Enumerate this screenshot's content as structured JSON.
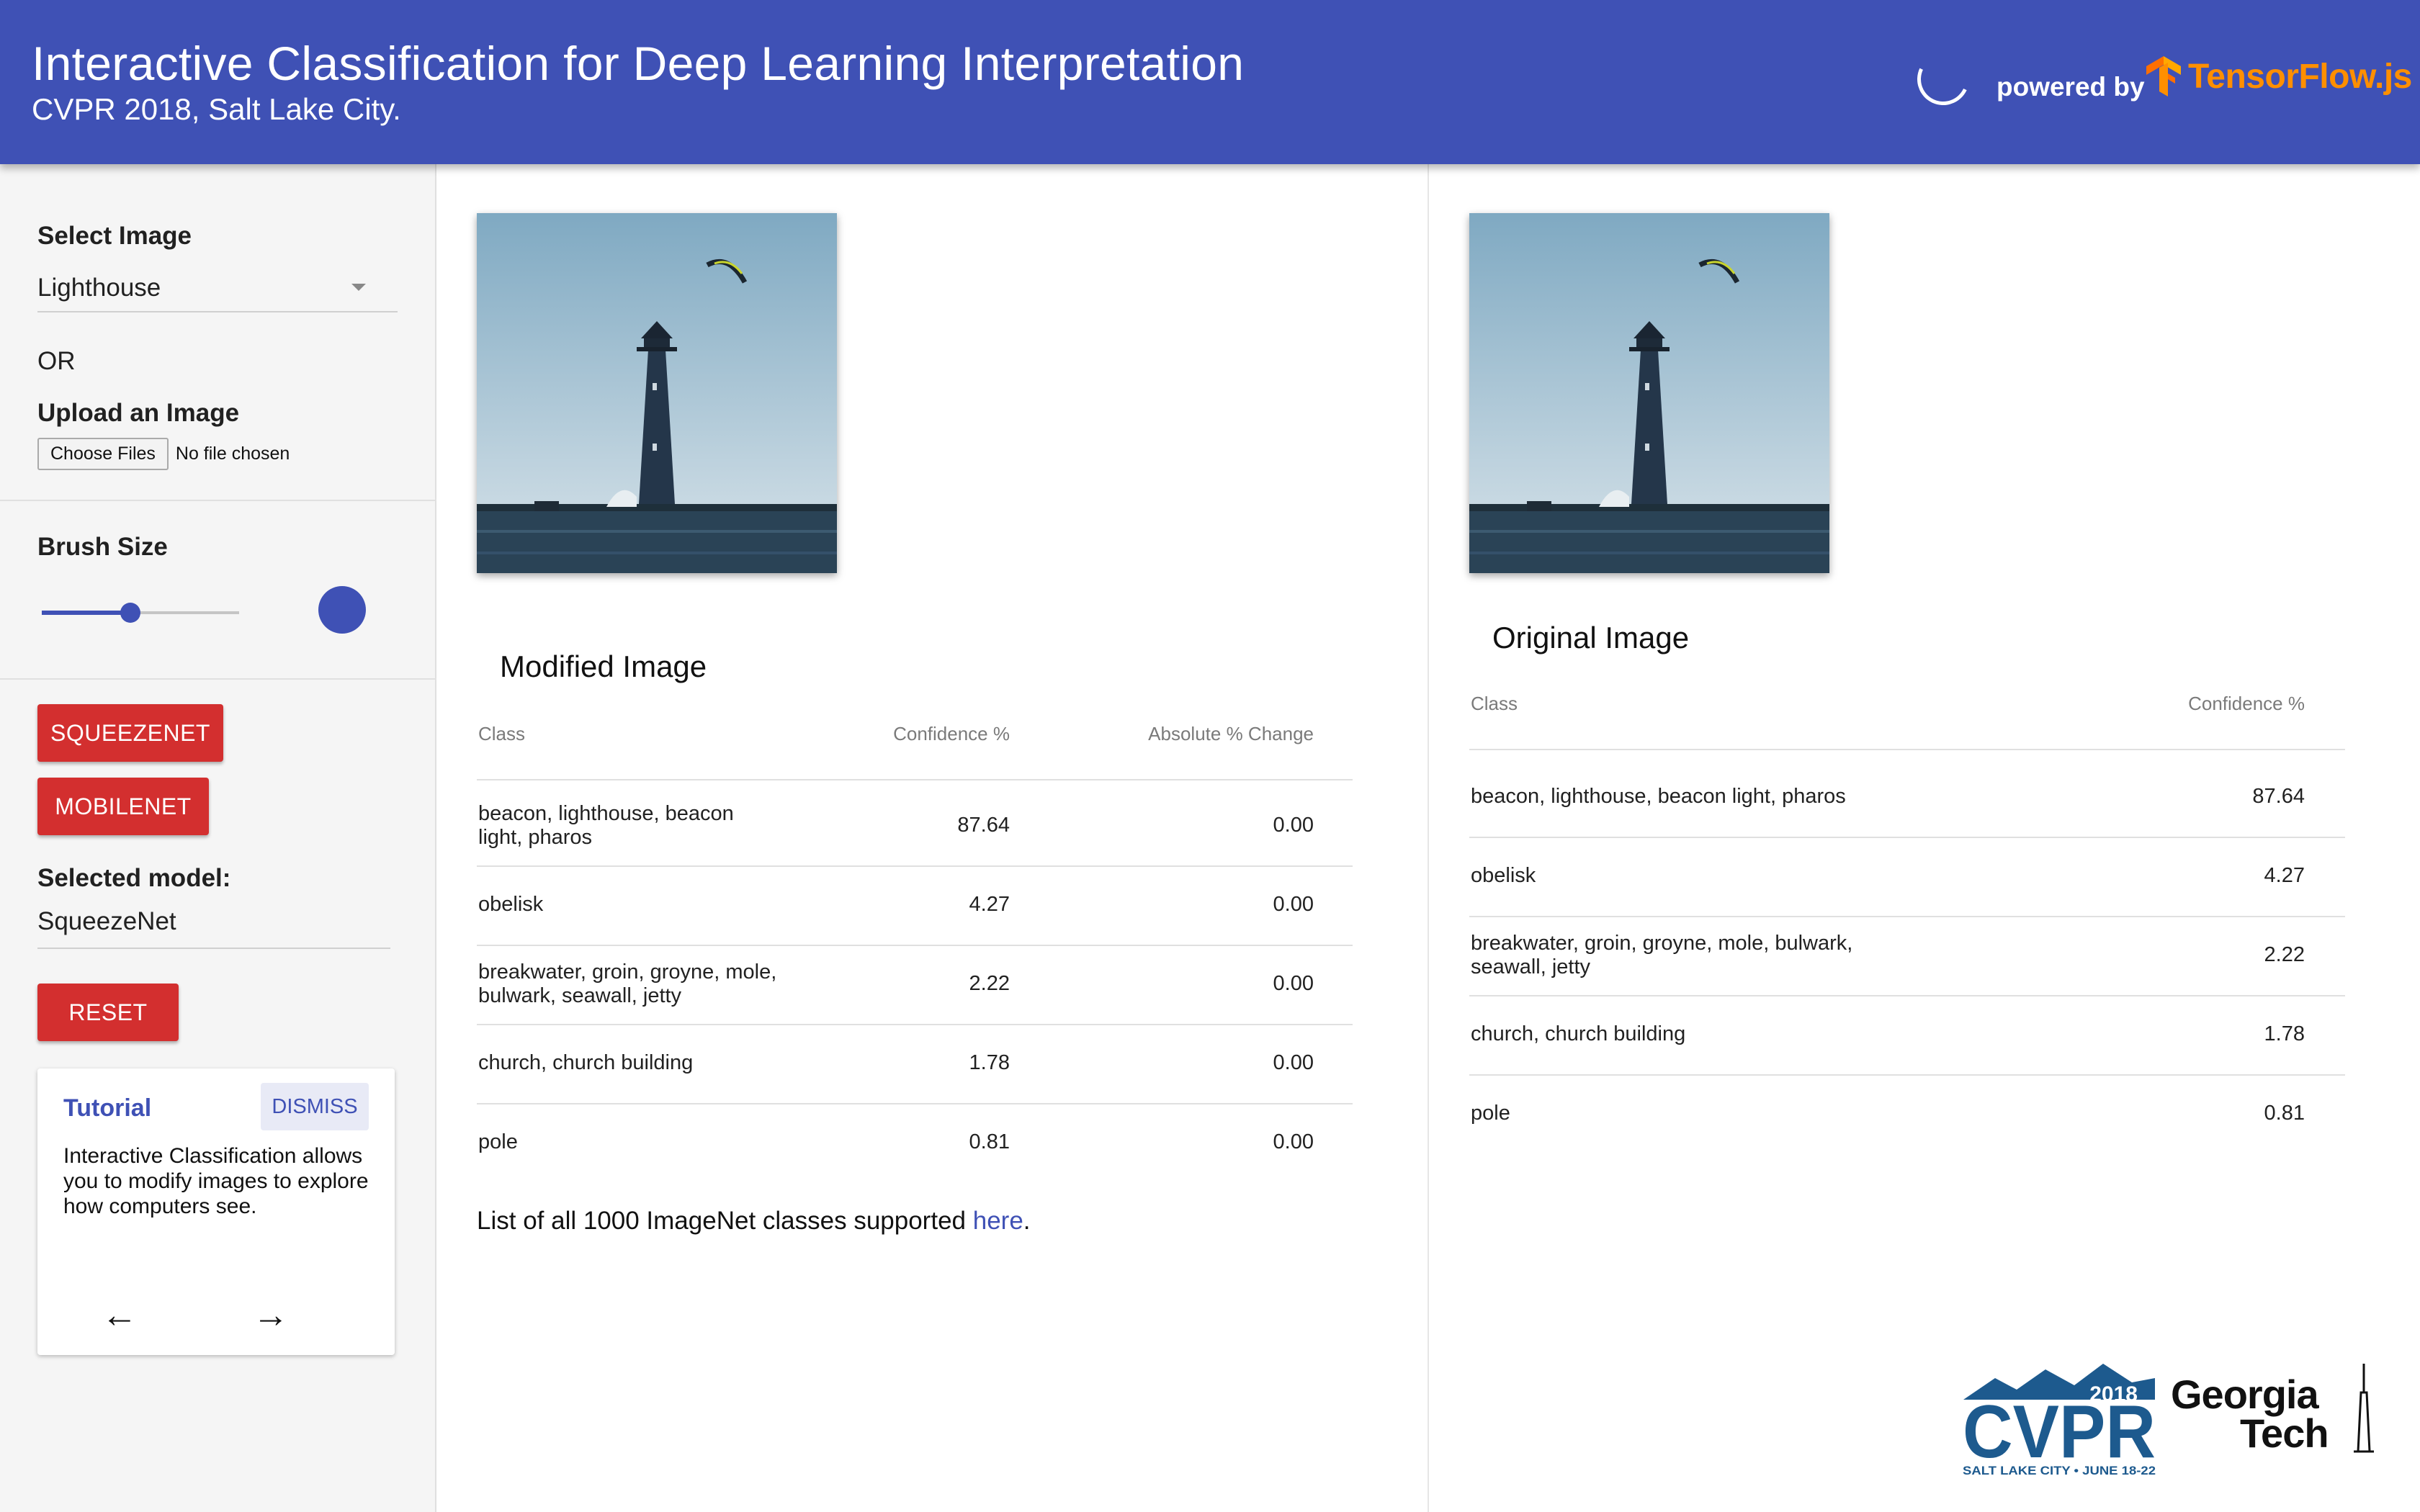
{
  "header": {
    "title": "Interactive Classification for Deep Learning Interpretation",
    "subtitle": "CVPR 2018, Salt Lake City.",
    "powered_by": "powered by",
    "tensorflow_label": "TensorFlow.js"
  },
  "sidebar": {
    "select_image_label": "Select Image",
    "selected_image": "Lighthouse",
    "or_label": "OR",
    "upload_label": "Upload an Image",
    "choose_files_label": "Choose Files",
    "no_file_label": "No file chosen",
    "brush_size_label": "Brush Size",
    "brush_size_fraction": 0.45,
    "models": [
      "SQUEEZENET",
      "MOBILENET"
    ],
    "selected_model_label": "Selected model:",
    "selected_model": "SqueezeNet",
    "reset_label": "RESET"
  },
  "tutorial": {
    "title": "Tutorial",
    "dismiss_label": "DISMISS",
    "body": "Interactive Classification allows you to modify images to explore how computers see.",
    "prev_icon": "arrow-left-icon",
    "next_icon": "arrow-right-icon"
  },
  "modified": {
    "title": "Modified Image",
    "headers": [
      "Class",
      "Confidence %",
      "Absolute % Change"
    ],
    "rows": [
      {
        "class": "beacon, lighthouse, beacon light, pharos",
        "confidence": "87.64",
        "change": "0.00"
      },
      {
        "class": "obelisk",
        "confidence": "4.27",
        "change": "0.00"
      },
      {
        "class": "breakwater, groin, groyne, mole, bulwark, seawall, jetty",
        "confidence": "2.22",
        "change": "0.00"
      },
      {
        "class": "church, church building",
        "confidence": "1.78",
        "change": "0.00"
      },
      {
        "class": "pole",
        "confidence": "0.81",
        "change": "0.00"
      }
    ],
    "footnote_text": "List of all 1000 ImageNet classes supported ",
    "footnote_link": "here",
    "footnote_end": "."
  },
  "original": {
    "title": "Original Image",
    "headers": [
      "Class",
      "Confidence %"
    ],
    "rows": [
      {
        "class": "beacon, lighthouse, beacon light, pharos",
        "confidence": "87.64"
      },
      {
        "class": "obelisk",
        "confidence": "4.27"
      },
      {
        "class": "breakwater, groin, groyne, mole, bulwark, seawall, jetty",
        "confidence": "2.22"
      },
      {
        "class": "church, church building",
        "confidence": "1.78"
      },
      {
        "class": "pole",
        "confidence": "0.81"
      }
    ]
  },
  "logos": {
    "cvpr_year": "2018",
    "cvpr_text": "CVPR",
    "cvpr_tagline": "SALT LAKE CITY • JUNE 18-22",
    "gatech_line1": "Georgia",
    "gatech_line2": "Tech"
  },
  "colors": {
    "primary": "#3f51b5",
    "accent_red": "#d32f2f",
    "tensorflow_orange": "#ff8f00"
  }
}
